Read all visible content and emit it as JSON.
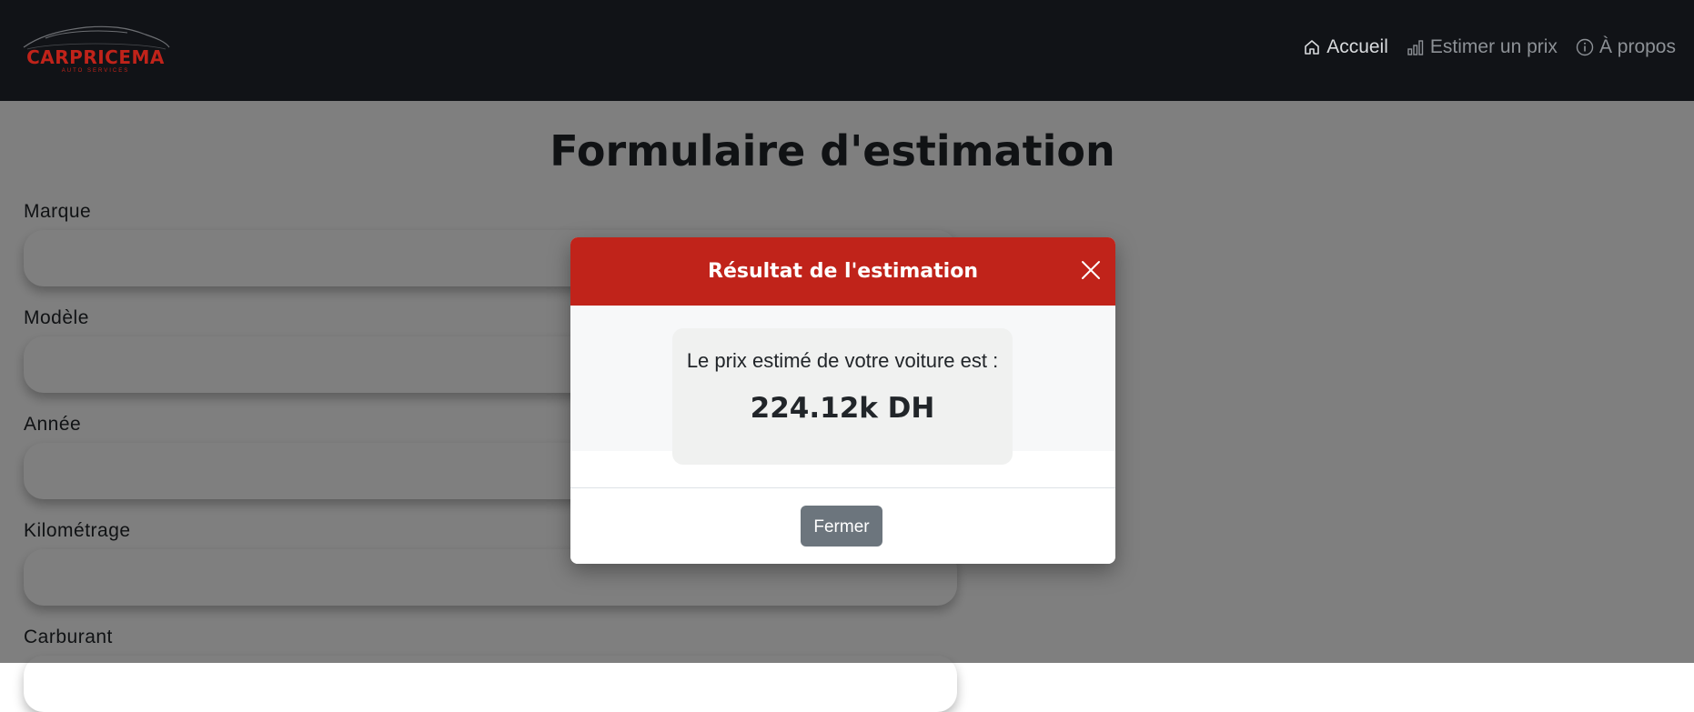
{
  "brand": {
    "name": "CARPRICEMA",
    "tagline": "AUTO SERVICES",
    "color": "#c0231a"
  },
  "nav": {
    "items": [
      {
        "label": "Accueil",
        "icon": "home-icon",
        "active": true
      },
      {
        "label": "Estimer un prix",
        "icon": "bar-chart-icon",
        "active": false
      },
      {
        "label": "À propos",
        "icon": "info-icon",
        "active": false
      }
    ]
  },
  "page": {
    "title": "Formulaire d'estimation",
    "fields": [
      {
        "label": "Marque",
        "value": ""
      },
      {
        "label": "Modèle",
        "value": ""
      },
      {
        "label": "Année",
        "value": ""
      },
      {
        "label": "Kilométrage",
        "value": ""
      },
      {
        "label": "Carburant",
        "value": ""
      }
    ]
  },
  "modal": {
    "title": "Résultat de l'estimation",
    "close_icon": "close-icon",
    "result_text": "Le prix estimé de votre voiture est :",
    "price": "224.12k DH",
    "close_button_label": "Fermer"
  },
  "colors": {
    "navbar_bg": "#111317",
    "accent": "#c0231a",
    "secondary_button": "#6c757d"
  }
}
